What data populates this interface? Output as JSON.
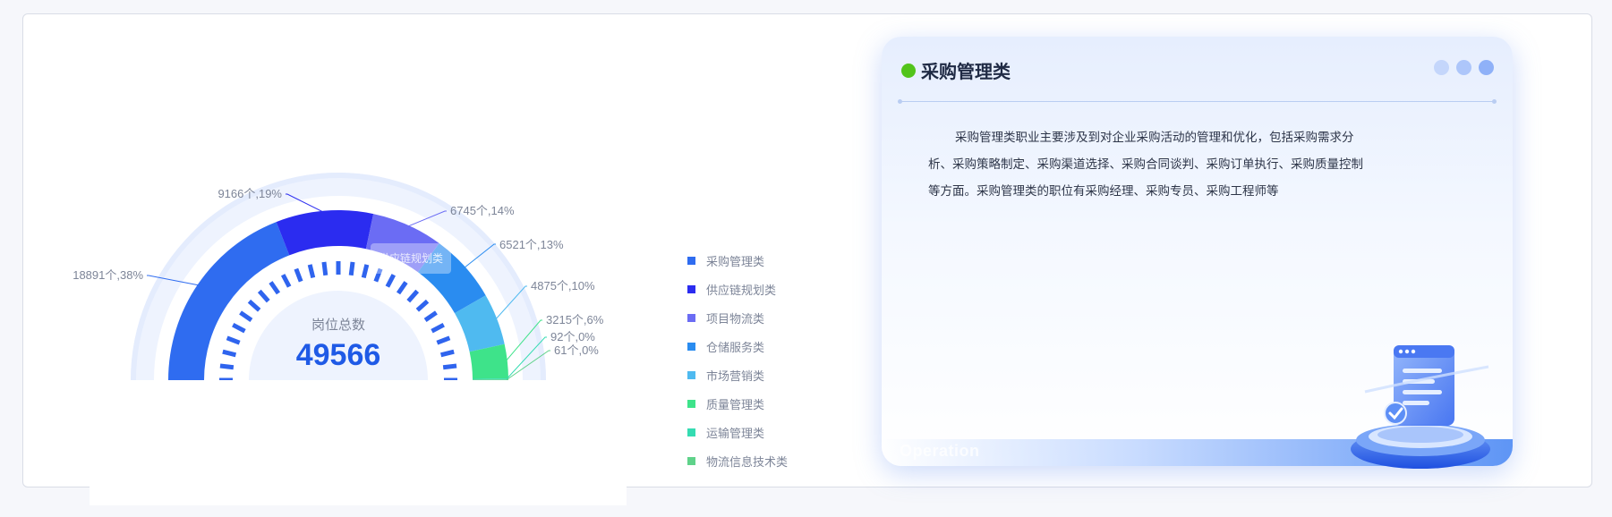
{
  "chart_data": {
    "type": "pie",
    "variant": "half-donut",
    "center_label": "岗位总数",
    "center_value": "49566",
    "hover_tooltip": "供应链规划类",
    "series": [
      {
        "name": "采购管理类",
        "value": 18891,
        "label": "18891个,38%",
        "color": "#2f6cf0"
      },
      {
        "name": "供应链规划类",
        "value": 9166,
        "label": "9166个,19%",
        "color": "#2b2cf0"
      },
      {
        "name": "项目物流类",
        "value": 6745,
        "label": "6745个,14%",
        "color": "#6b6cf4"
      },
      {
        "name": "仓储服务类",
        "value": 6521,
        "label": "6521个,13%",
        "color": "#2a8cf0"
      },
      {
        "name": "市场营销类",
        "value": 4875,
        "label": "4875个,10%",
        "color": "#4fbaf0"
      },
      {
        "name": "质量管理类",
        "value": 3215,
        "label": "3215个,6%",
        "color": "#3ee38a"
      },
      {
        "name": "运输管理类",
        "value": 92,
        "label": "92个,0%",
        "color": "#35dcb2"
      },
      {
        "name": "物流信息技术类",
        "value": 61,
        "label": "61个,0%",
        "color": "#5fd28a"
      }
    ],
    "legend_position": "right"
  },
  "card": {
    "title": "采购管理类",
    "description": "采购管理类职业主要涉及到对企业采购活动的管理和优化，包括采购需求分析、采购策略制定、采购渠道选择、采购合同谈判、采购订单执行、采购质量控制等方面。采购管理类的职位有采购经理、采购专员、采购工程师等",
    "footer_text": "Operation",
    "accent": "#52c41a",
    "window_dots": [
      "#c4d6fb",
      "#adc6fa",
      "#8fb1f8"
    ]
  }
}
